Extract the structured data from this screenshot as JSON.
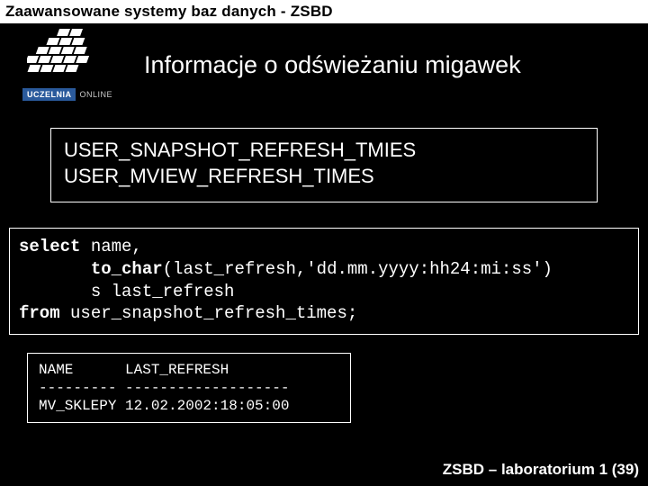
{
  "header": "Zaawansowane systemy baz danych - ZSBD",
  "logo": {
    "uczelnia": "UCZELNIA",
    "online": "ONLINE"
  },
  "title": "Informacje o odświeżaniu migawek",
  "views": {
    "line1": "USER_SNAPSHOT_REFRESH_TMIES",
    "line2": "USER_MVIEW_REFRESH_TIMES"
  },
  "sql": {
    "kw_select": "select",
    "t1": " name,",
    "pad": "       ",
    "kw_tochar": "to_char",
    "t2": "(last_refresh,'dd.mm.yyyy:hh24:mi:ss')",
    "t3": "s last_refresh",
    "kw_from": "from",
    "t4": " user_snapshot_refresh_times;"
  },
  "result": {
    "header": "NAME      LAST_REFRESH",
    "divider": "--------- -------------------",
    "row1": "MV_SKLEPY 12.02.2002:18:05:00"
  },
  "footer": "ZSBD – laboratorium 1 (39)"
}
